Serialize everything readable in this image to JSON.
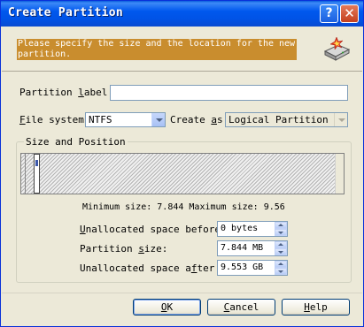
{
  "window": {
    "title": "Create Partition",
    "help_button": "?",
    "close_button": "✕"
  },
  "header": {
    "instruction": "Please specify the size and the location for the new partition."
  },
  "form": {
    "partition_label": {
      "label_pre": "Partition ",
      "label_accel": "l",
      "label_post": "abel:",
      "value": ""
    },
    "file_system": {
      "label_pre": "",
      "label_accel": "F",
      "label_post": "ile system:",
      "value": "NTFS"
    },
    "create_as": {
      "label_pre": "Create ",
      "label_accel": "a",
      "label_post": "s:",
      "value": "Logical Partition"
    }
  },
  "size_position": {
    "group_title": "Size and Position",
    "minmax_text": "Minimum size: 7.844 Maximum size: 9.56 (",
    "unallocated_before": {
      "label_pre": "",
      "label_accel": "U",
      "label_post": "nallocated space before:",
      "value": "0 bytes"
    },
    "partition_size": {
      "label_pre": "Partition ",
      "label_accel": "s",
      "label_post": "ize:",
      "value": "7.844 MB"
    },
    "unallocated_after": {
      "label_pre": "Unallocated space a",
      "label_accel": "f",
      "label_post": "ter:",
      "value": "9.553 GB"
    }
  },
  "buttons": {
    "ok": {
      "accel": "O",
      "rest": "K"
    },
    "cancel": {
      "accel": "C",
      "rest": "ancel"
    },
    "help": {
      "accel": "H",
      "rest": "elp"
    }
  },
  "icons": {
    "disk": "disk-partition-icon"
  },
  "colors": {
    "titlebar": "#0058ee",
    "highlight": "#c98d2e",
    "dialog_bg": "#ece9d8"
  }
}
